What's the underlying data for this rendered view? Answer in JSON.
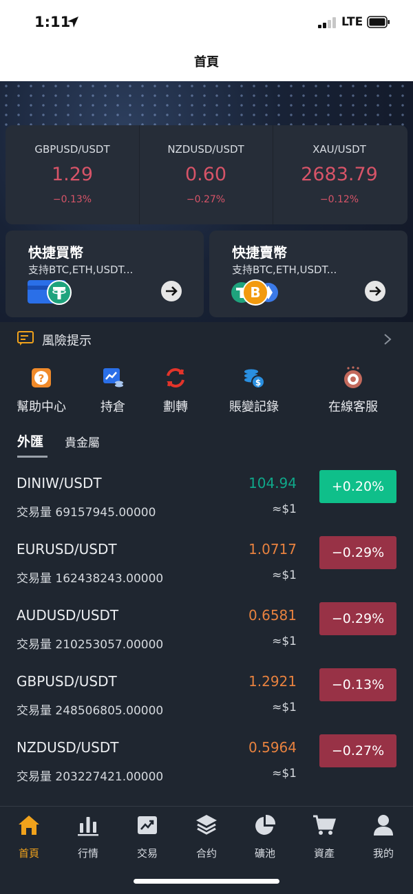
{
  "status_bar": {
    "time": "1:11",
    "network": "LTE"
  },
  "header": {
    "title": "首頁"
  },
  "tickers": [
    {
      "symbol": "GBPUSD/USDT",
      "price": "1.29",
      "change": "−0.13%"
    },
    {
      "symbol": "NZDUSD/USDT",
      "price": "0.60",
      "change": "−0.27%"
    },
    {
      "symbol": "XAU/USDT",
      "price": "2683.79",
      "change": "−0.12%"
    }
  ],
  "quick_buy": {
    "title": "快捷買幣",
    "subtitle": "支持BTC,ETH,USDT..."
  },
  "quick_sell": {
    "title": "快捷賣幣",
    "subtitle": "支持BTC,ETH,USDT..."
  },
  "risk_notice": {
    "label": "風險提示"
  },
  "shortcuts": [
    {
      "label": "幫助中心",
      "icon": "help-icon"
    },
    {
      "label": "持倉",
      "icon": "positions-icon"
    },
    {
      "label": "劃轉",
      "icon": "transfer-icon"
    },
    {
      "label": "賬變記錄",
      "icon": "records-icon"
    },
    {
      "label": "在線客服",
      "icon": "support-icon"
    }
  ],
  "tabs": [
    {
      "label": "外匯",
      "active": true
    },
    {
      "label": "貴金屬",
      "active": false
    }
  ],
  "market_rows": [
    {
      "pair": "DINIW/USDT",
      "volume": "交易量 69157945.00000",
      "price": "104.94",
      "usd": "≈$1",
      "change": "+0.20%",
      "direction": "up"
    },
    {
      "pair": "EURUSD/USDT",
      "volume": "交易量 162438243.00000",
      "price": "1.0717",
      "usd": "≈$1",
      "change": "−0.29%",
      "direction": "down"
    },
    {
      "pair": "AUDUSD/USDT",
      "volume": "交易量 210253057.00000",
      "price": "0.6581",
      "usd": "≈$1",
      "change": "−0.29%",
      "direction": "down"
    },
    {
      "pair": "GBPUSD/USDT",
      "volume": "交易量 248506805.00000",
      "price": "1.2921",
      "usd": "≈$1",
      "change": "−0.13%",
      "direction": "down"
    },
    {
      "pair": "NZDUSD/USDT",
      "volume": "交易量 203227421.00000",
      "price": "0.5964",
      "usd": "≈$1",
      "change": "−0.27%",
      "direction": "down"
    }
  ],
  "bottom_nav": [
    {
      "label": "首頁",
      "icon": "home-icon",
      "active": true
    },
    {
      "label": "行情",
      "icon": "market-chart-icon"
    },
    {
      "label": "交易",
      "icon": "trade-icon"
    },
    {
      "label": "合约",
      "icon": "contract-layers-icon"
    },
    {
      "label": "礦池",
      "icon": "pool-pie-icon"
    },
    {
      "label": "資產",
      "icon": "assets-cart-icon"
    },
    {
      "label": "我的",
      "icon": "profile-icon"
    }
  ],
  "colors": {
    "up": "#0fbf8a",
    "down": "#983246",
    "up_text": "#0fa88a",
    "down_text": "#e8823f",
    "accent": "#f0a21c",
    "negative": "#d75468"
  }
}
